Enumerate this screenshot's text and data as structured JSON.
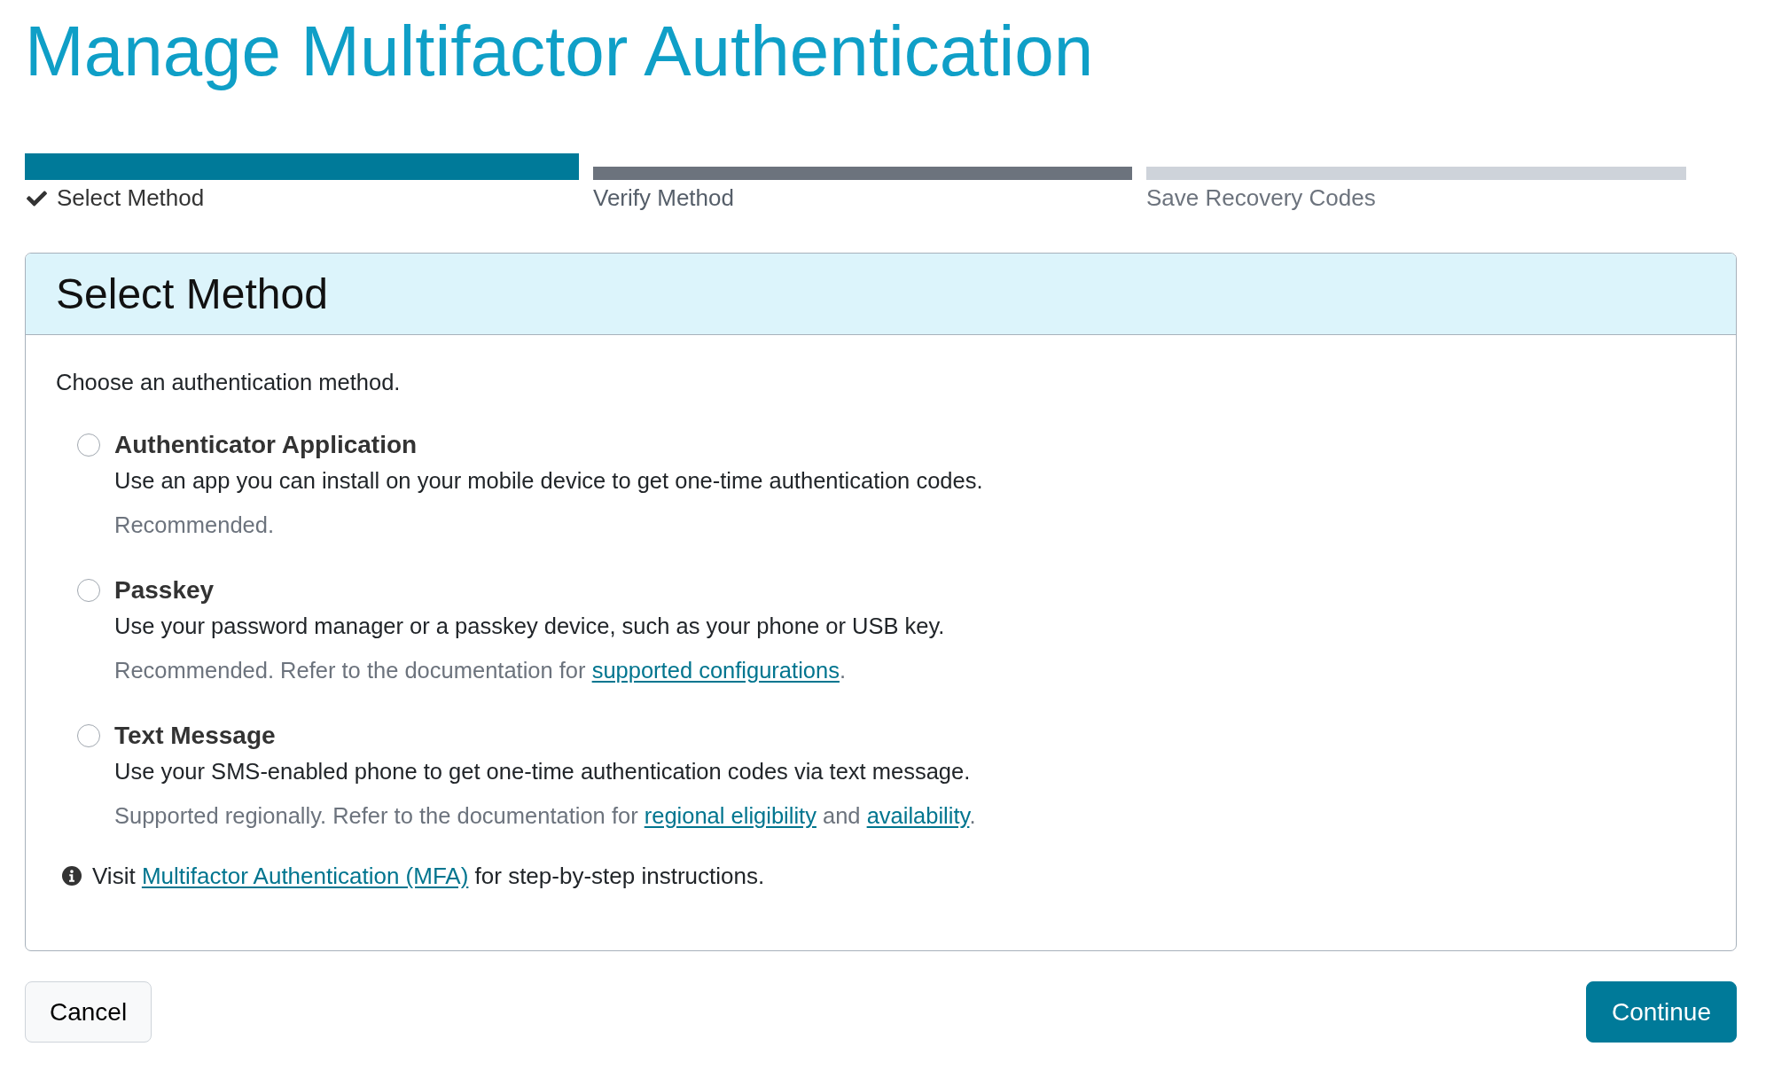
{
  "page_title": "Manage Multifactor Authentication",
  "steps": [
    {
      "label": "Select Method",
      "checked": true,
      "selected": true,
      "disabled": false
    },
    {
      "label": "Verify Method",
      "checked": false,
      "selected": false,
      "disabled": false
    },
    {
      "label": "Save Recovery Codes",
      "checked": false,
      "selected": false,
      "disabled": true
    }
  ],
  "panel": {
    "title": "Select Method",
    "intro": "Choose an authentication method.",
    "options": [
      {
        "title": "Authenticator Application",
        "selected": false,
        "description": "Use an app you can install on your mobile device to get one-time authentication codes.",
        "note": [
          {
            "kind": "text",
            "text": "Recommended."
          }
        ]
      },
      {
        "title": "Passkey",
        "selected": false,
        "description": "Use your password manager or a passkey device, such as your phone or USB key.",
        "note": [
          {
            "kind": "text",
            "text": "Recommended. Refer to the documentation for "
          },
          {
            "kind": "link",
            "text": "supported configurations"
          },
          {
            "kind": "text",
            "text": "."
          }
        ]
      },
      {
        "title": "Text Message",
        "selected": false,
        "description": "Use your SMS-enabled phone to get one-time authentication codes via text message.",
        "note": [
          {
            "kind": "text",
            "text": "Supported regionally. Refer to the documentation for "
          },
          {
            "kind": "link",
            "text": "regional eligibility"
          },
          {
            "kind": "text",
            "text": " and "
          },
          {
            "kind": "link",
            "text": "availability"
          },
          {
            "kind": "text",
            "text": "."
          }
        ]
      }
    ],
    "info": [
      {
        "kind": "text",
        "text": "Visit "
      },
      {
        "kind": "link",
        "text": "Multifactor Authentication (MFA)"
      },
      {
        "kind": "text",
        "text": " for step-by-step instructions."
      }
    ]
  },
  "buttons": [
    {
      "label": "Cancel",
      "kind": "secondary"
    },
    {
      "label": "Continue",
      "kind": "primary"
    }
  ]
}
